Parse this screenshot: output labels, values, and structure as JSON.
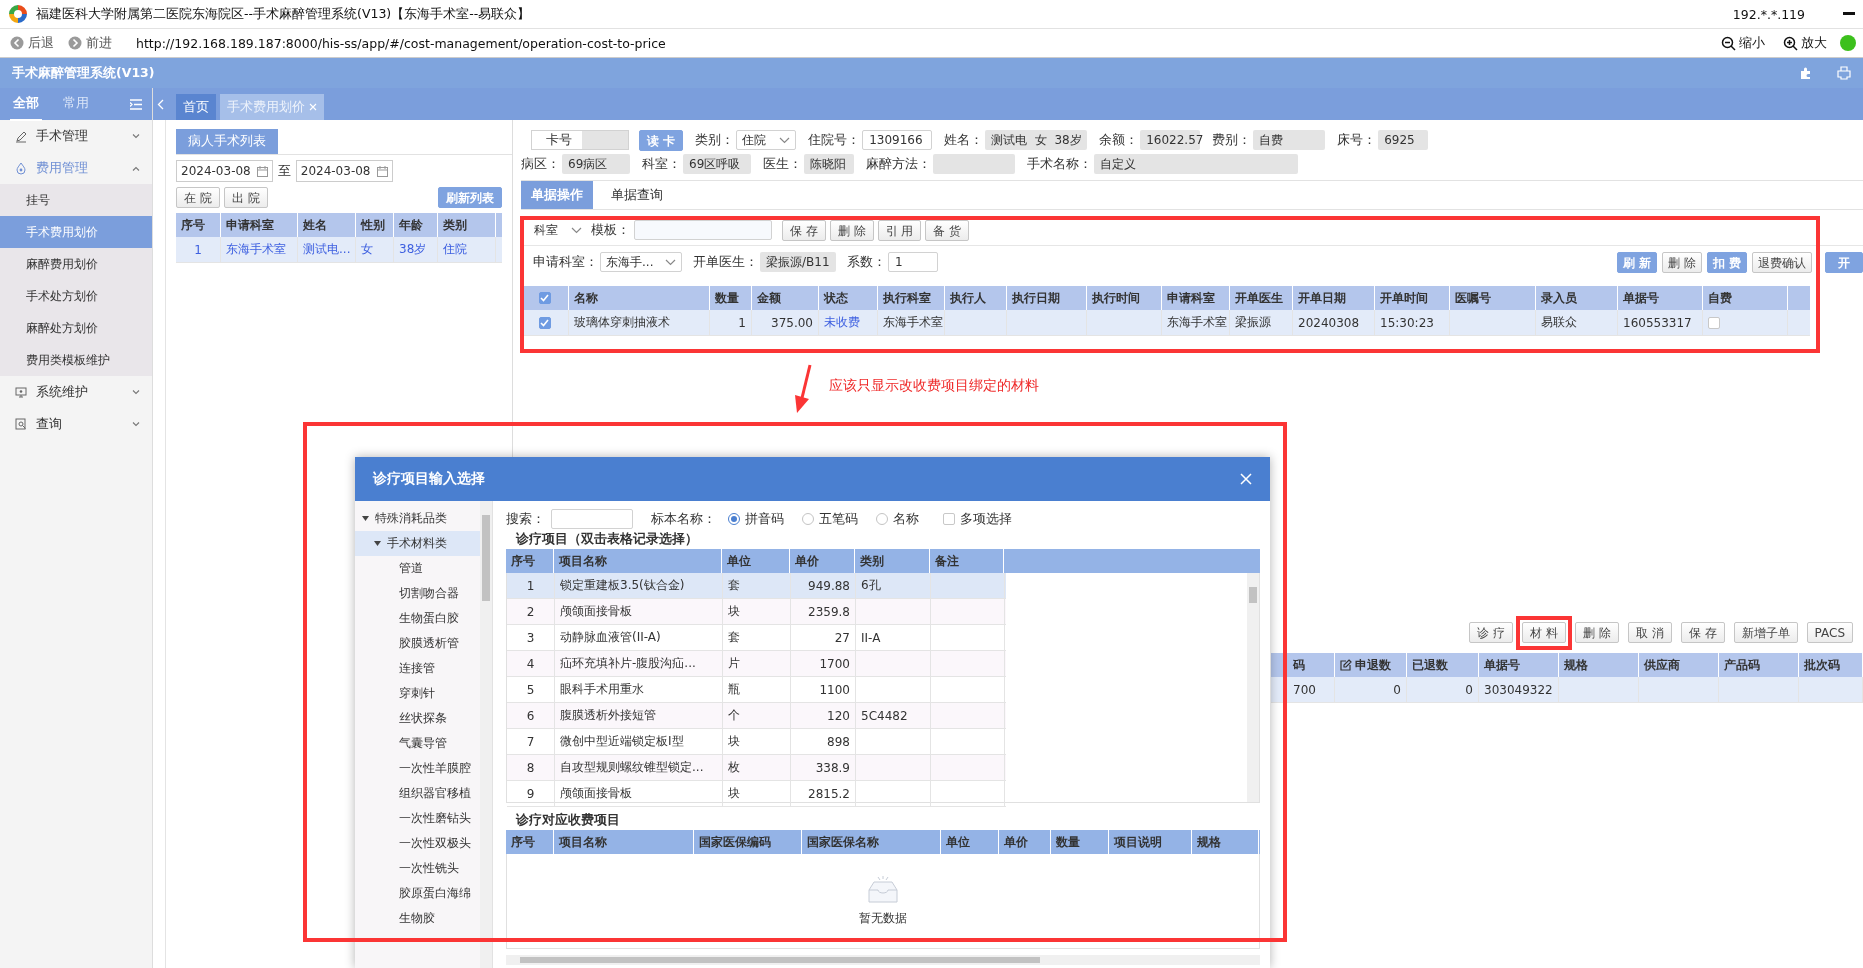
{
  "title_bar": {
    "title": "福建医科大学附属第二医院东海院区--手术麻醉管理系统(V13)【东海手术室--易联众】",
    "ip": "192.*.*.119"
  },
  "address_bar": {
    "back": "后退",
    "forward": "前进",
    "url": "http://192.168.189.187:8000/his-ss/app/#/cost-management/operation-cost-to-price",
    "zoom_out": "缩小",
    "zoom_in": "放大"
  },
  "app_header": {
    "title": "手术麻醉管理系统(V13)"
  },
  "sidebar": {
    "tabs": [
      {
        "label": "全部",
        "selected": true
      },
      {
        "label": "常用",
        "selected": false
      }
    ],
    "items": [
      {
        "label": "手术管理",
        "expanded": false
      },
      {
        "label": "费用管理",
        "expanded": true,
        "children": [
          {
            "label": "挂号",
            "selected": false
          },
          {
            "label": "手术费用划价",
            "selected": true
          },
          {
            "label": "麻醉费用划价",
            "selected": false
          },
          {
            "label": "手术处方划价",
            "selected": false
          },
          {
            "label": "麻醉处方划价",
            "selected": false
          },
          {
            "label": "费用类模板维护",
            "selected": false
          }
        ]
      },
      {
        "label": "系统维护",
        "expanded": false
      },
      {
        "label": "查询",
        "expanded": false
      }
    ]
  },
  "page_tabs": [
    {
      "label": "首页",
      "selected": false,
      "closable": false
    },
    {
      "label": "手术费用划价",
      "selected": true,
      "closable": true
    }
  ],
  "patient_panel": {
    "title": "病人手术列表",
    "date_from": "2024-03-08",
    "date_sep": "至",
    "date_to": "2024-03-08",
    "buttons": [
      "在 院",
      "出 院"
    ],
    "refresh": "刷新列表",
    "columns": [
      "序号",
      "申请科室",
      "姓名",
      "性别",
      "年龄",
      "类别"
    ],
    "rows": [
      {
        "selected": true,
        "cells": [
          "1",
          "东海手术室",
          "测试电...",
          "女",
          "38岁",
          "住院"
        ]
      }
    ]
  },
  "patient_info": {
    "row1": [
      {
        "kind": "card",
        "label": "卡号"
      },
      {
        "kind": "button",
        "label": "读 卡"
      },
      {
        "kind": "select",
        "label": "类别：",
        "value": "住院"
      },
      {
        "kind": "input",
        "label": "住院号：",
        "value": "1309166"
      },
      {
        "kind": "readonly",
        "label": "姓名：",
        "value": "测试电  女  38岁"
      },
      {
        "kind": "readonly",
        "label": "余额：",
        "value": "16022.57"
      },
      {
        "kind": "readonly",
        "label": "费别：",
        "value": "自费"
      },
      {
        "kind": "readonly",
        "label": "床号：",
        "value": "6925"
      }
    ],
    "row2": [
      {
        "kind": "readonly",
        "label": "病区：",
        "value": "69病区"
      },
      {
        "kind": "readonly",
        "label": "科室：",
        "value": "69区呼吸"
      },
      {
        "kind": "readonly",
        "label": "医生：",
        "value": "陈晓阳"
      },
      {
        "kind": "readonly",
        "label": "麻醉方法："
      },
      {
        "kind": "readonly",
        "label": "手术名称：",
        "value": "自定义"
      }
    ]
  },
  "doc_tabs": [
    {
      "label": "单据操作",
      "selected": true
    },
    {
      "label": "单据查询",
      "selected": false
    }
  ],
  "toolbar": {
    "dept": "科室",
    "template_label": "模板：",
    "buttons": [
      "保 存",
      "删 除",
      "引 用",
      "备 货"
    ]
  },
  "order_bar": {
    "fields": [
      {
        "kind": "select",
        "label": "申请科室：",
        "value": "东海手..."
      },
      {
        "kind": "readonly",
        "label": "开单医生：",
        "value": "梁振源/B11"
      },
      {
        "kind": "input",
        "label": "系数：",
        "value": "1"
      }
    ],
    "buttons": [
      {
        "label": "刷 新",
        "primary": true
      },
      {
        "label": "删 除",
        "primary": false
      },
      {
        "label": "扣 费",
        "primary": true
      },
      {
        "label": "退费确认",
        "primary": false
      },
      {
        "label": "开",
        "primary": true
      }
    ]
  },
  "charges_table": {
    "header_checked": true,
    "columns": [
      "名称",
      "数量",
      "金额",
      "状态",
      "执行科室",
      "执行人",
      "执行日期",
      "执行时间",
      "申请科室",
      "开单医生",
      "开单日期",
      "开单时间",
      "医嘱号",
      "录入员",
      "单据号",
      "自费"
    ],
    "rows": [
      {
        "checked": true,
        "self_pay": false,
        "cells": [
          "玻璃体穿刺抽液术",
          "1",
          "375.00",
          "未收费",
          "东海手术室",
          null,
          null,
          null,
          "东海手术室",
          "梁振源",
          "20240308",
          "15:30:23",
          null,
          "易联众",
          "160553317"
        ]
      }
    ]
  },
  "annotation": {
    "text": "应该只显示改收费项目绑定的材料"
  },
  "lower": {
    "buttons": [
      "诊 疗",
      "材 料",
      "删 除",
      "取 消",
      "保 存",
      "新增子单",
      "PACS"
    ],
    "columns": [
      {
        "label": "码",
        "editable": false
      },
      {
        "label": "申退数",
        "editable": true
      },
      {
        "label": "已退数",
        "editable": false
      },
      {
        "label": "单据号",
        "editable": false
      },
      {
        "label": "规格",
        "editable": false
      },
      {
        "label": "供应商",
        "editable": false
      },
      {
        "label": "产品码",
        "editable": false
      },
      {
        "label": "批次码",
        "editable": false
      }
    ],
    "rows": [
      {
        "selected": true,
        "cells": [
          "700",
          "0",
          "0",
          "303049322",
          null,
          null,
          null,
          null
        ]
      }
    ]
  },
  "dialog": {
    "title": "诊疗项目输入选择",
    "tree": [
      {
        "label": "特殊消耗品类",
        "expanded": true,
        "selected": false,
        "children": [
          {
            "label": "手术材料类",
            "expanded": true,
            "selected": true,
            "children": [
              {
                "label": "管道",
                "selected": false
              },
              {
                "label": "切割吻合器",
                "selected": false
              },
              {
                "label": "生物蛋白胶",
                "selected": false
              },
              {
                "label": "胶膜透析管",
                "selected": false
              },
              {
                "label": "连接管",
                "selected": false
              },
              {
                "label": "穿刺针",
                "selected": false
              },
              {
                "label": "丝状探条",
                "selected": false
              },
              {
                "label": "气囊导管",
                "selected": false
              },
              {
                "label": "一次性羊膜腔",
                "selected": false
              },
              {
                "label": "组织器官移植",
                "selected": false
              },
              {
                "label": "一次性磨钻头",
                "selected": false
              },
              {
                "label": "一次性双极头",
                "selected": false
              },
              {
                "label": "一次性铣头",
                "selected": false
              },
              {
                "label": "胶原蛋白海绵",
                "selected": false
              },
              {
                "label": "生物胶",
                "selected": false
              }
            ]
          }
        ]
      }
    ],
    "search_label": "搜索：",
    "name_label": "标本名称：",
    "radios": [
      {
        "label": "拼音码",
        "selected": true
      },
      {
        "label": "五笔码",
        "selected": false
      },
      {
        "label": "名称",
        "selected": false
      }
    ],
    "multi": {
      "label": "多项选择",
      "checked": false
    },
    "items_title": "诊疗项目（双击表格记录选择）",
    "items_columns": [
      "序号",
      "项目名称",
      "单位",
      "单价",
      "类别",
      "备注"
    ],
    "items_rows": [
      {
        "selected": true,
        "cells": [
          "1",
          "锁定重建板3.5(钛合金)",
          "套",
          "949.88",
          "6孔",
          null
        ]
      },
      {
        "selected": false,
        "cells": [
          "2",
          "颅颌面接骨板",
          "块",
          "2359.8",
          null,
          null
        ]
      },
      {
        "selected": false,
        "cells": [
          "3",
          "动静脉血液管(II-A)",
          "套",
          "27",
          "II-A",
          null
        ]
      },
      {
        "selected": false,
        "cells": [
          "4",
          "疝环充填补片-腹股沟疝...",
          "片",
          "1700",
          null,
          null
        ]
      },
      {
        "selected": false,
        "cells": [
          "5",
          "眼科手术用重水",
          "瓶",
          "1100",
          null,
          null
        ]
      },
      {
        "selected": false,
        "cells": [
          "6",
          "腹膜透析外接短管",
          "个",
          "120",
          "5C4482",
          null
        ]
      },
      {
        "selected": false,
        "cells": [
          "7",
          "微创中型近端锁定板I型",
          "块",
          "898",
          null,
          null
        ]
      },
      {
        "selected": false,
        "cells": [
          "8",
          "自攻型规则螺纹锥型锁定...",
          "枚",
          "338.9",
          null,
          null
        ]
      },
      {
        "selected": false,
        "cells": [
          "9",
          "颅颌面接骨板",
          "块",
          "2815.2",
          null,
          null
        ]
      }
    ],
    "charges_title": "诊疗对应收费项目",
    "charges_columns": [
      "序号",
      "项目名称",
      "国家医保编码",
      "国家医保名称",
      "单位",
      "单价",
      "数量",
      "项目说明",
      "规格"
    ],
    "empty_text": "暂无数据"
  }
}
